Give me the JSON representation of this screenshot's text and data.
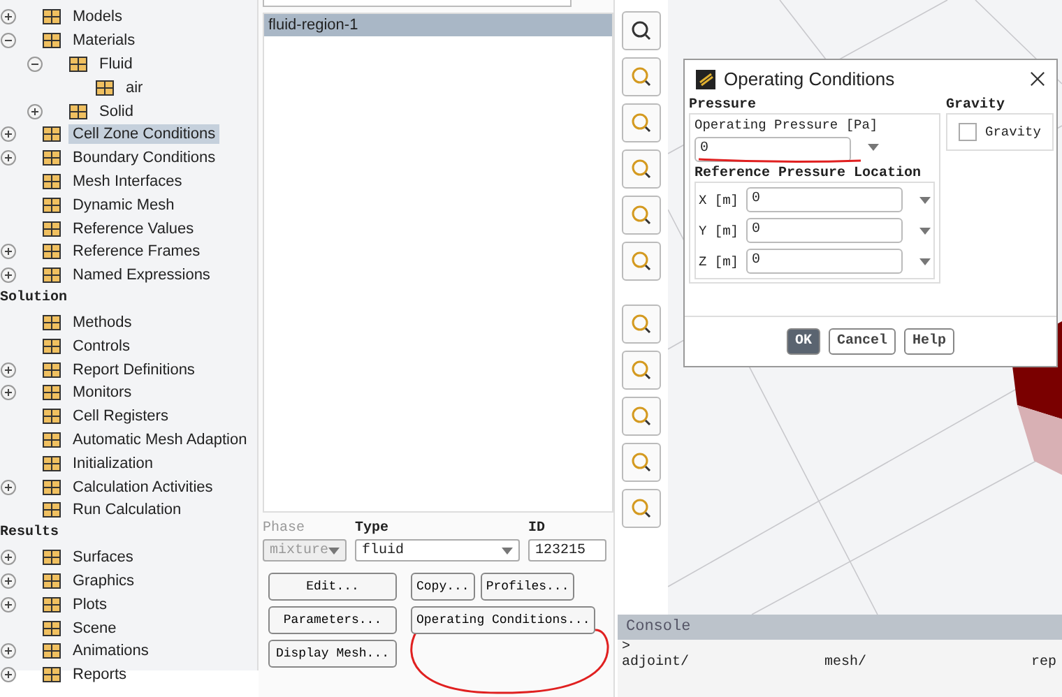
{
  "tree": [
    {
      "kind": "item",
      "label": "Models",
      "expanded": false,
      "selected": false
    },
    {
      "kind": "item",
      "label": "Materials",
      "expanded": true,
      "selected": false,
      "children": [
        {
          "kind": "item",
          "label": "Fluid",
          "expanded": true,
          "selected": false,
          "children": [
            {
              "kind": "item",
              "label": "air",
              "selected": false
            }
          ]
        },
        {
          "kind": "item",
          "label": "Solid",
          "expanded": false,
          "selected": false
        }
      ]
    },
    {
      "kind": "item",
      "label": "Cell Zone Conditions",
      "expanded": false,
      "selected": true
    },
    {
      "kind": "item",
      "label": "Boundary Conditions",
      "expanded": false,
      "selected": false
    },
    {
      "kind": "item",
      "label": "Mesh Interfaces",
      "selected": false
    },
    {
      "kind": "item",
      "label": "Dynamic Mesh",
      "selected": false
    },
    {
      "kind": "item",
      "label": "Reference Values",
      "selected": false
    },
    {
      "kind": "item",
      "label": "Reference Frames",
      "expanded": false,
      "selected": false
    },
    {
      "kind": "item",
      "label": "Named Expressions",
      "expanded": false,
      "selected": false
    },
    {
      "kind": "section",
      "label": "Solution"
    },
    {
      "kind": "item",
      "label": "Methods",
      "selected": false
    },
    {
      "kind": "item",
      "label": "Controls",
      "selected": false
    },
    {
      "kind": "item",
      "label": "Report Definitions",
      "expanded": false,
      "selected": false
    },
    {
      "kind": "item",
      "label": "Monitors",
      "expanded": false,
      "selected": false
    },
    {
      "kind": "item",
      "label": "Cell Registers",
      "selected": false
    },
    {
      "kind": "item",
      "label": "Automatic Mesh Adaption",
      "selected": false
    },
    {
      "kind": "item",
      "label": "Initialization",
      "selected": false
    },
    {
      "kind": "item",
      "label": "Calculation Activities",
      "expanded": false,
      "selected": false
    },
    {
      "kind": "item",
      "label": "Run Calculation",
      "selected": false
    },
    {
      "kind": "section",
      "label": "Results"
    },
    {
      "kind": "item",
      "label": "Surfaces",
      "expanded": false,
      "selected": false
    },
    {
      "kind": "item",
      "label": "Graphics",
      "expanded": false,
      "selected": false
    },
    {
      "kind": "item",
      "label": "Plots",
      "expanded": false,
      "selected": false
    },
    {
      "kind": "item",
      "label": "Scene",
      "selected": false
    },
    {
      "kind": "item",
      "label": "Animations",
      "expanded": false,
      "selected": false
    },
    {
      "kind": "item",
      "label": "Reports",
      "expanded": false,
      "selected": false
    }
  ],
  "zones": {
    "list": [
      {
        "label": "fluid-region-1",
        "selected": true
      }
    ],
    "phase": {
      "label": "Phase",
      "value": "mixture",
      "disabled": true
    },
    "type": {
      "label": "Type",
      "value": "fluid"
    },
    "id": {
      "label": "ID",
      "value": "123215"
    },
    "left_buttons": [
      "Edit...",
      "Parameters...",
      "Display Mesh..."
    ],
    "right_buttons": [
      [
        "Copy...",
        "Profiles..."
      ],
      [
        "Operating Conditions..."
      ]
    ]
  },
  "dialog": {
    "title": "Operating Conditions",
    "pressure": {
      "title": "Pressure",
      "operating_label": "Operating Pressure [Pa]",
      "operating_value": "0",
      "location_title": "Reference Pressure Location",
      "location": [
        {
          "label": "X [m]",
          "value": "0"
        },
        {
          "label": "Y [m]",
          "value": "0"
        },
        {
          "label": "Z [m]",
          "value": "0"
        }
      ]
    },
    "gravity": {
      "title": "Gravity",
      "label": "Gravity",
      "checked": false
    },
    "buttons": [
      {
        "label": "OK",
        "default": true
      },
      {
        "label": "Cancel",
        "default": false
      },
      {
        "label": "Help",
        "default": false
      }
    ]
  },
  "console": {
    "title": "Console",
    "prompt": ">",
    "entries": [
      "adjoint/",
      "mesh/",
      "rep"
    ]
  }
}
